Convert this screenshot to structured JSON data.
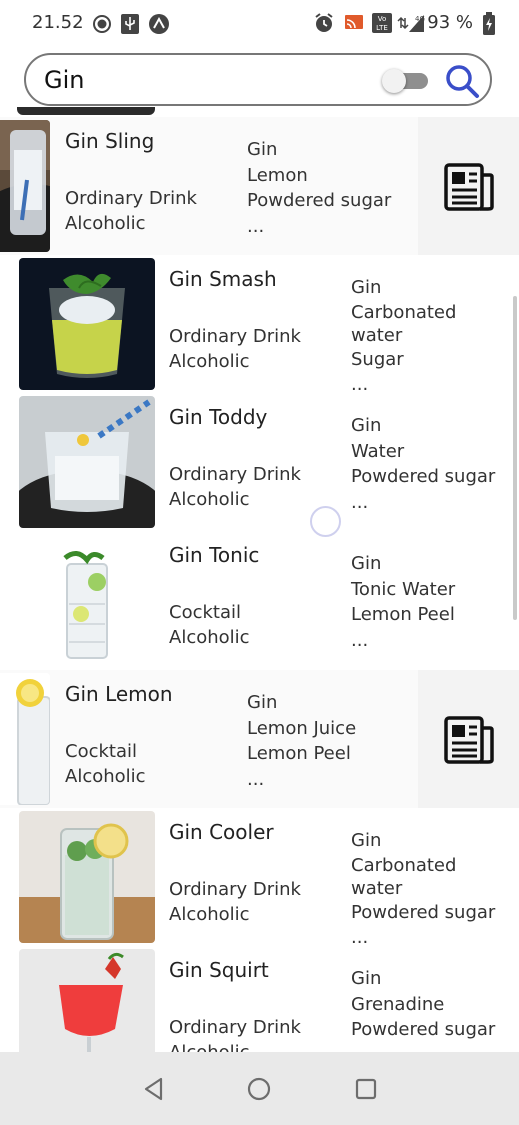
{
  "status_bar": {
    "time": "21.52",
    "battery_percent": "93 %",
    "network": "4G+"
  },
  "search": {
    "query": "Gin",
    "placeholder": "",
    "toggle_on": false,
    "accent_color": "#3a4ec9"
  },
  "drinks": [
    {
      "name": "Gin Sling",
      "category": "Ordinary Drink",
      "alcoholic": "Alcoholic",
      "ingredients": [
        "Gin",
        "Lemon",
        "Powdered sugar",
        "..."
      ],
      "shifted": true
    },
    {
      "name": "Gin Smash",
      "category": "Ordinary Drink",
      "alcoholic": "Alcoholic",
      "ingredients": [
        "Gin",
        "Carbonated water",
        "Sugar",
        "..."
      ],
      "shifted": false
    },
    {
      "name": "Gin Toddy",
      "category": "Ordinary Drink",
      "alcoholic": "Alcoholic",
      "ingredients": [
        "Gin",
        "Water",
        "Powdered sugar",
        "..."
      ],
      "shifted": false
    },
    {
      "name": "Gin Tonic",
      "category": "Cocktail",
      "alcoholic": "Alcoholic",
      "ingredients": [
        "Gin",
        "Tonic Water",
        "Lemon Peel",
        "..."
      ],
      "shifted": false
    },
    {
      "name": "Gin Lemon",
      "category": "Cocktail",
      "alcoholic": "Alcoholic",
      "ingredients": [
        "Gin",
        "Lemon Juice",
        "Lemon Peel",
        "..."
      ],
      "shifted": true
    },
    {
      "name": "Gin Cooler",
      "category": "Ordinary Drink",
      "alcoholic": "Alcoholic",
      "ingredients": [
        "Gin",
        "Carbonated water",
        "Powdered sugar",
        "..."
      ],
      "shifted": false
    },
    {
      "name": "Gin Squirt",
      "category": "Ordinary Drink",
      "alcoholic": "Alcoholic",
      "ingredients": [
        "Gin",
        "Grenadine",
        "Powdered sugar",
        "..."
      ],
      "shifted": false
    }
  ],
  "icons": {
    "detail": "newspaper-icon",
    "search": "search-icon",
    "nav_back": "back-icon",
    "nav_home": "home-icon",
    "nav_recents": "recents-icon"
  }
}
